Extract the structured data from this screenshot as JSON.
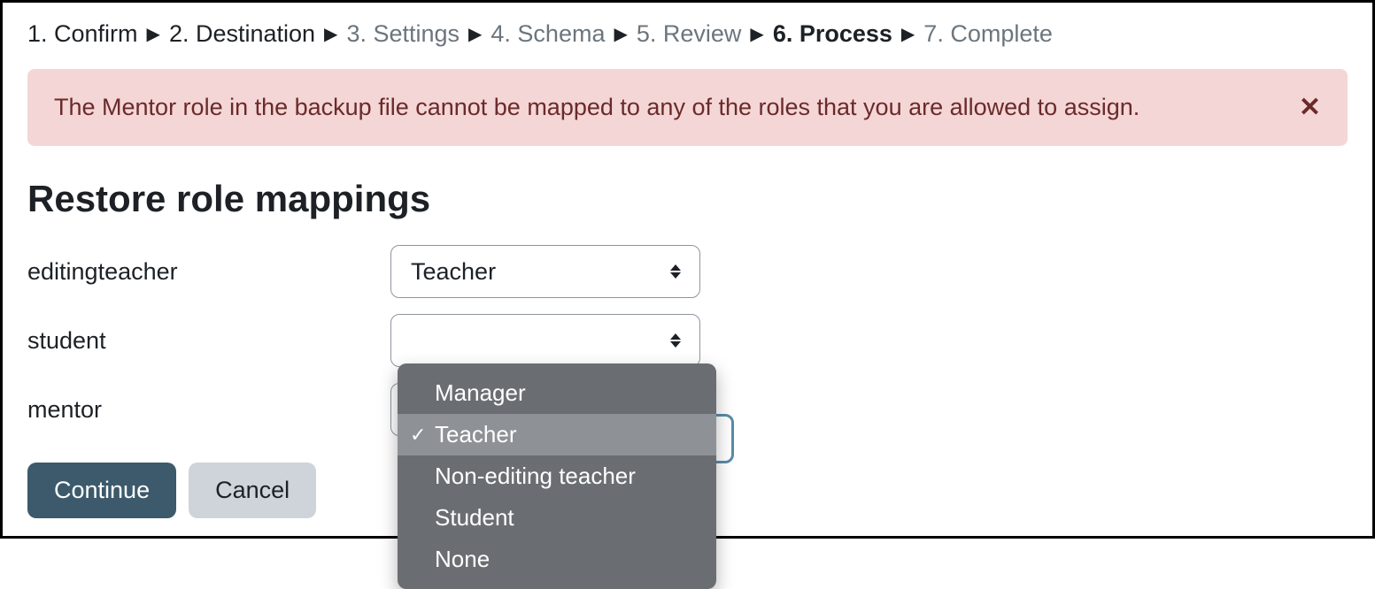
{
  "breadcrumb": {
    "steps": [
      {
        "label": "1. Confirm",
        "state": "done"
      },
      {
        "label": "2. Destination",
        "state": "done"
      },
      {
        "label": "3. Settings",
        "state": "future"
      },
      {
        "label": "4. Schema",
        "state": "future"
      },
      {
        "label": "5. Review",
        "state": "future"
      },
      {
        "label": "6. Process",
        "state": "current"
      },
      {
        "label": "7. Complete",
        "state": "future"
      }
    ]
  },
  "alert": {
    "message": "The Mentor role in the backup file cannot be mapped to any of the roles that you are allowed to assign.",
    "close_label": "✕"
  },
  "page": {
    "title": "Restore role mappings"
  },
  "mappings": {
    "editingteacher": {
      "label": "editingteacher",
      "selected": "Teacher"
    },
    "student": {
      "label": "student",
      "selected": ""
    },
    "mentor": {
      "label": "mentor",
      "selected": ""
    }
  },
  "dropdown": {
    "options": [
      {
        "label": "Manager",
        "selected": false
      },
      {
        "label": "Teacher",
        "selected": true
      },
      {
        "label": "Non-editing teacher",
        "selected": false
      },
      {
        "label": "Student",
        "selected": false
      },
      {
        "label": "None",
        "selected": false
      }
    ]
  },
  "buttons": {
    "continue": "Continue",
    "cancel": "Cancel"
  }
}
